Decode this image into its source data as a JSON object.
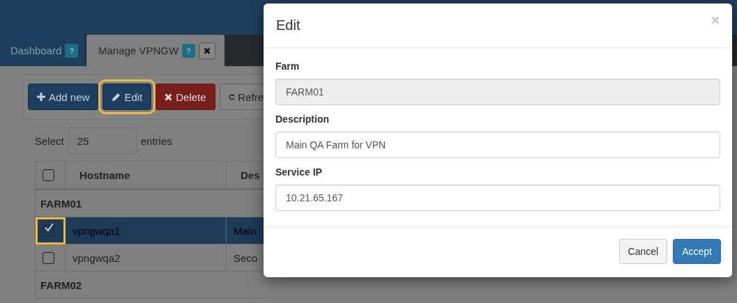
{
  "tabs": [
    {
      "label": "Dashboard",
      "help": "?",
      "selected": false,
      "closable": false
    },
    {
      "label": "Manage VPNGW",
      "help": "?",
      "selected": true,
      "closable": true
    }
  ],
  "toolbar": [
    {
      "kind": "add",
      "label": "Add new",
      "highlighted": false
    },
    {
      "kind": "edit",
      "label": "Edit",
      "highlighted": true
    },
    {
      "kind": "delete",
      "label": "Delete",
      "highlighted": false
    },
    {
      "kind": "refresh",
      "label": "Refre",
      "highlighted": false
    }
  ],
  "page_size": {
    "label": "Select",
    "value": "25",
    "suffix": "entries"
  },
  "table": {
    "select_all": {
      "checked": false
    },
    "columns": [
      "Hostname",
      "Des"
    ],
    "rows": [
      {
        "kind": "group",
        "label": "FARM01"
      },
      {
        "kind": "item",
        "hostname": "vpngwqa1",
        "description": "Main",
        "checked": true,
        "selected": true,
        "highlighted": true
      },
      {
        "kind": "item",
        "hostname": "vpngwqa2",
        "description": "Seco",
        "checked": false,
        "selected": false,
        "highlighted": false
      },
      {
        "kind": "group",
        "label": "FARM02"
      }
    ]
  },
  "modal": {
    "title": "Edit",
    "close": "×",
    "fields": [
      {
        "label": "Farm",
        "value": "FARM01",
        "disabled": true
      },
      {
        "label": "Description",
        "value": "Main QA Farm for VPN",
        "disabled": false
      },
      {
        "label": "Service IP",
        "value": "10.21.65.167",
        "disabled": false
      }
    ],
    "buttons": [
      {
        "kind": "default",
        "label": "Cancel"
      },
      {
        "kind": "primary",
        "label": "Accept"
      }
    ]
  }
}
